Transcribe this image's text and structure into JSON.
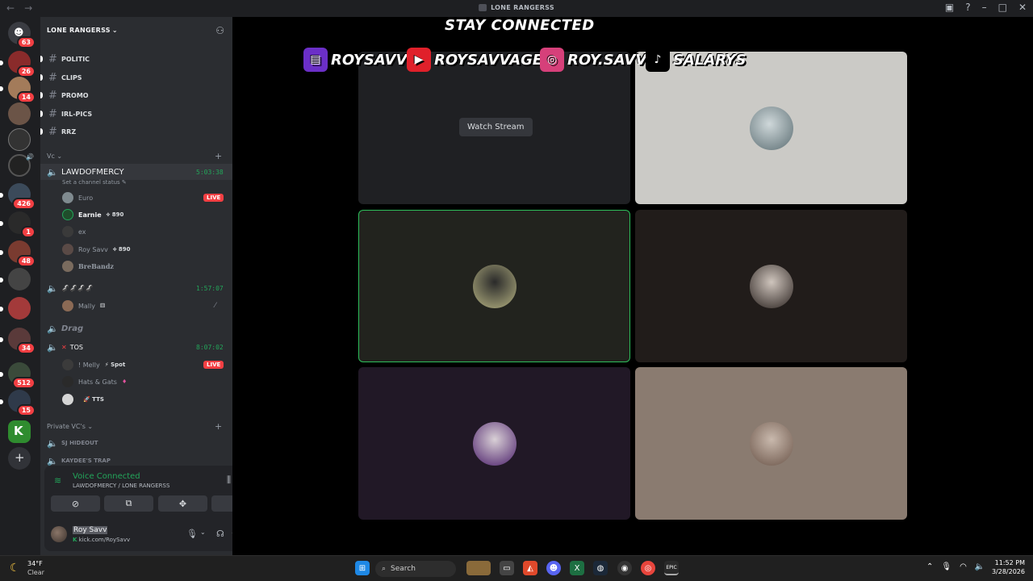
{
  "window": {
    "title": "LONE RANGERSS"
  },
  "server_badges": [
    "63",
    "26",
    "14",
    "426",
    "1",
    "48",
    "34",
    "512",
    "15"
  ],
  "guild": {
    "name": "LONE RANGERSS"
  },
  "text_channels": [
    "POLITIC",
    "CLIPS",
    "PROMO",
    "IRL-PICS",
    "RRZ"
  ],
  "categories": {
    "vc": "Vc",
    "private": "Private VC's"
  },
  "voice": {
    "main": {
      "name": "LAWDOFMERCY",
      "time": "5:03:38",
      "status": "Set a channel status"
    },
    "main_users": [
      {
        "name": "Euro",
        "live": "LIVE"
      },
      {
        "name": "Earnie",
        "tag": "⟡ 890"
      },
      {
        "name": "ex"
      },
      {
        "name": "Roy Savv",
        "tag": "⟡ 890"
      },
      {
        "name": "BreBandz"
      }
    ],
    "second": {
      "name": "🦨🦨🦨🦨",
      "time": "1:57:07"
    },
    "second_users": [
      {
        "name": "Mally"
      }
    ],
    "drag": {
      "name": "Drag"
    },
    "tos": {
      "name": "TOS",
      "time": "8:07:02"
    },
    "tos_users": [
      {
        "name": "! Melly",
        "tag": "⚡ Spot",
        "live": "LIVE"
      },
      {
        "name": "Hats & Gats"
      },
      {
        "name": "",
        "tag": "🚀 TTS"
      }
    ],
    "private": [
      {
        "name": "SJ HIDEOUT"
      },
      {
        "name": "KAYDEE'S TRAP"
      }
    ]
  },
  "panel": {
    "status": "Voice Connected",
    "channel": "LAWDOFMERCY / LONE RANGERSS",
    "user": {
      "name": "Roy Savv",
      "sub": "kick.com/RoySavv"
    }
  },
  "stage": {
    "overlay_title": "STAY CONNECTED",
    "socials": [
      "ROYSAVV",
      "ROYSAVVAGE",
      "ROY.SAVV",
      "SALARYS"
    ],
    "watch_label": "Watch Stream"
  },
  "taskbar": {
    "temp": "34°F",
    "condition": "Clear",
    "search_placeholder": "Search",
    "time": "11:52 PM",
    "date": "3/28/2026"
  },
  "colors": {
    "accent_green": "#23a55a",
    "live_red": "#f23f43",
    "bg_sidebar": "#2b2d31"
  }
}
